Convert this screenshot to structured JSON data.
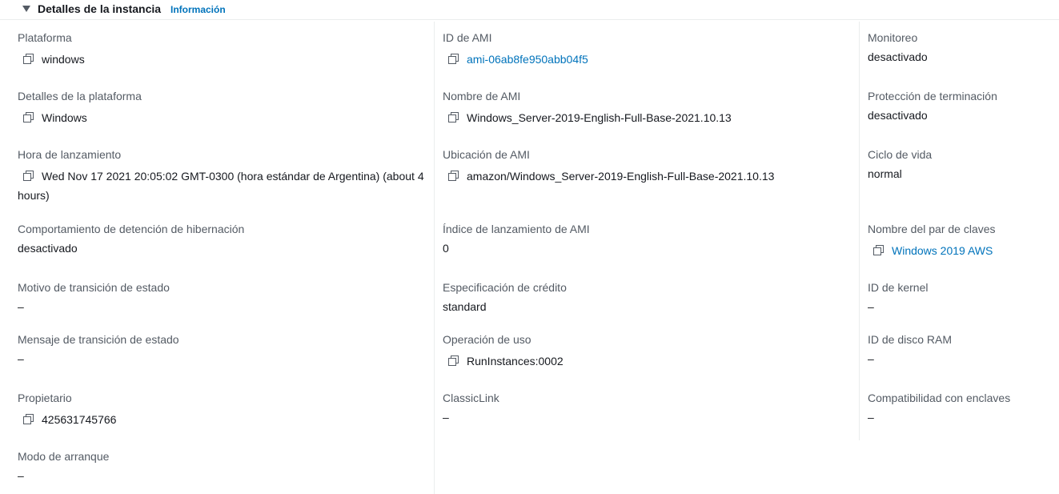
{
  "header": {
    "title": "Detalles de la instancia",
    "info_link": "Información"
  },
  "col1": {
    "platform": {
      "label": "Plataforma",
      "value": "windows"
    },
    "platform_details": {
      "label": "Detalles de la plataforma",
      "value": "Windows"
    },
    "launch_time": {
      "label": "Hora de lanzamiento",
      "value": "Wed Nov 17 2021 20:05:02 GMT-0300 (hora estándar de Argentina) (about 4 hours)"
    },
    "hibernation": {
      "label": "Comportamiento de detención de hibernación",
      "value": "desactivado"
    },
    "state_reason": {
      "label": "Motivo de transición de estado",
      "value": "–"
    },
    "state_message": {
      "label": "Mensaje de transición de estado",
      "value": "–"
    },
    "owner": {
      "label": "Propietario",
      "value": "425631745766"
    },
    "boot_mode": {
      "label": "Modo de arranque",
      "value": "–"
    }
  },
  "col2": {
    "ami_id": {
      "label": "ID de AMI",
      "value": "ami-06ab8fe950abb04f5"
    },
    "ami_name": {
      "label": "Nombre de AMI",
      "value": "Windows_Server-2019-English-Full-Base-2021.10.13"
    },
    "ami_location": {
      "label": "Ubicación de AMI",
      "value": "amazon/Windows_Server-2019-English-Full-Base-2021.10.13"
    },
    "ami_launch_index": {
      "label": "Índice de lanzamiento de AMI",
      "value": "0"
    },
    "credit_spec": {
      "label": "Especificación de crédito",
      "value": "standard"
    },
    "usage_operation": {
      "label": "Operación de uso",
      "value": "RunInstances:0002"
    },
    "classiclink": {
      "label": "ClassicLink",
      "value": "–"
    }
  },
  "col3": {
    "monitoring": {
      "label": "Monitoreo",
      "value": "desactivado"
    },
    "termination_protection": {
      "label": "Protección de terminación",
      "value": "desactivado"
    },
    "lifecycle": {
      "label": "Ciclo de vida",
      "value": "normal"
    },
    "key_pair": {
      "label": "Nombre del par de claves",
      "value": "Windows 2019 AWS"
    },
    "kernel_id": {
      "label": "ID de kernel",
      "value": "–"
    },
    "ramdisk_id": {
      "label": "ID de disco RAM",
      "value": "–"
    },
    "enclave_support": {
      "label": "Compatibilidad con enclaves",
      "value": "–"
    }
  },
  "colors": {
    "link": "#0073bb",
    "label": "#545b64",
    "text": "#16191f",
    "divider": "#eaeded"
  }
}
